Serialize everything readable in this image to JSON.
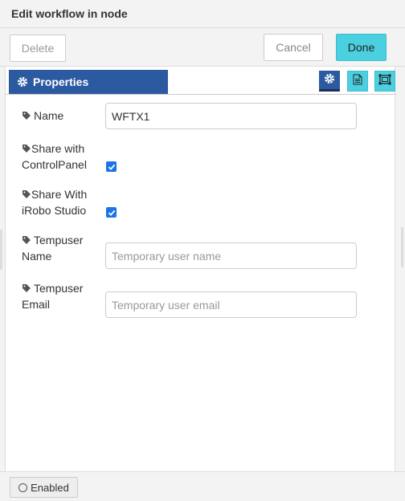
{
  "header": {
    "title": "Edit workflow in node"
  },
  "toolbar": {
    "delete_label": "Delete",
    "cancel_label": "Cancel",
    "done_label": "Done"
  },
  "tabs": {
    "properties_label": "Properties",
    "icons": [
      "gear-icon",
      "document-icon",
      "frame-icon"
    ]
  },
  "form": {
    "name": {
      "label": "Name",
      "value": "WFTX1"
    },
    "share_control_panel": {
      "label_line1": "Share with",
      "label_line2": "ControlPanel",
      "checked": true
    },
    "share_irobo": {
      "label_line1": "Share With",
      "label_line2": "iRobo Studio",
      "checked": true
    },
    "tempuser_name": {
      "label_line1": "Tempuser",
      "label_line2": "Name",
      "placeholder": "Temporary user name"
    },
    "tempuser_email": {
      "label_line1": "Tempuser",
      "label_line2": "Email",
      "placeholder": "Temporary user email"
    }
  },
  "footer": {
    "enabled_label": "Enabled"
  },
  "colors": {
    "accent": "#2c5aa0",
    "primary_button": "#4ad0e0",
    "checkbox": "#1a73e8"
  }
}
